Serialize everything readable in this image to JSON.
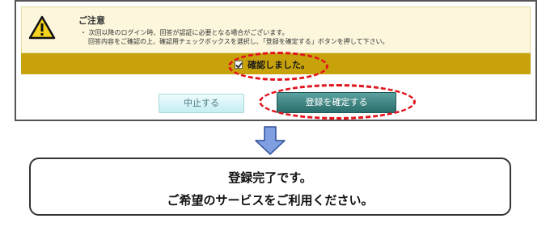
{
  "notice": {
    "title": "ご注意",
    "line1": "・ 次回以降のログイン時、回答が認証に必要となる場合がございます。",
    "line2": "回答内容をご確認の上、確認用チェックボックスを選択し、「登録を確定する」ボタンを押して下さい。"
  },
  "confirm": {
    "checked": true,
    "label": "確認しました。"
  },
  "buttons": {
    "cancel_label": "中止する",
    "submit_label": "登録を確定する"
  },
  "colors": {
    "notice_bg": "#fbf6dc",
    "confirm_bar": "#c8a20a",
    "submit_button": "#2b6e6c",
    "cancel_button": "#c4eef3",
    "highlight_oval": "#e2141d",
    "arrow": "#7f9fe0"
  },
  "icons": {
    "warning": "warning-triangle-icon",
    "arrow": "arrow-down-icon"
  },
  "result": {
    "line1": "登録完了です。",
    "line2": "ご希望のサービスをご利用ください。"
  }
}
